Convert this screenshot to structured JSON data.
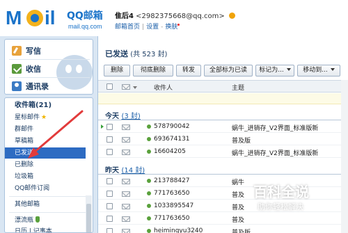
{
  "header": {
    "logo": "MOil QQ邮箱 mail.qq.com",
    "user_name": "隹后4",
    "user_email": "<2982375668@qq.com>",
    "links": [
      "邮箱首页",
      "设置",
      "换肤"
    ]
  },
  "sidebar": {
    "quick": [
      {
        "label": "写信",
        "icon": "compose-icon"
      },
      {
        "label": "收信",
        "icon": "inbox-icon"
      },
      {
        "label": "通讯录",
        "icon": "contacts-icon"
      }
    ],
    "folders": [
      {
        "label": "收件箱(21)"
      },
      {
        "label": "星标邮件"
      },
      {
        "label": "群邮件"
      },
      {
        "label": "草稿箱"
      },
      {
        "label": "已发送"
      },
      {
        "label": "已删除"
      },
      {
        "label": "垃圾箱"
      },
      {
        "label": "QQ邮件订阅"
      },
      {
        "label": "其他邮箱"
      },
      {
        "label": "漂流瓶"
      },
      {
        "label": "日历 | 记事本"
      }
    ]
  },
  "main": {
    "title": "已发送",
    "count_text": "(共 523 封)",
    "toolbar": {
      "delete": "删除",
      "perm_delete": "彻底删除",
      "forward": "转发",
      "mark_all_read": "全部标为已读",
      "mark_as": "标记为...",
      "move_to": "移动到..."
    },
    "columns": {
      "recipient": "收件人",
      "subject": "主题"
    },
    "groups": [
      {
        "label": "今天",
        "count": "(3 封)",
        "rows": [
          {
            "recipient": "578790042",
            "subject": "蜗牛_进销存_V2界面_标准版新"
          },
          {
            "recipient": "693674131",
            "subject": "普及版"
          },
          {
            "recipient": "16604205",
            "subject": "蜗牛_进销存_V2界面_标准版新"
          }
        ]
      },
      {
        "label": "昨天",
        "count": "(14 封)",
        "rows": [
          {
            "recipient": "213788427",
            "subject": "蜗牛"
          },
          {
            "recipient": "771763650",
            "subject": "普及"
          },
          {
            "recipient": "1033895547",
            "subject": "普及"
          },
          {
            "recipient": "771763650",
            "subject": "普及"
          },
          {
            "recipient": "heiminqyu3240",
            "subject": "普及版"
          }
        ]
      }
    ]
  },
  "watermark": {
    "title": "百科全说",
    "subtitle": "助你轻松解决"
  },
  "colors": {
    "accent": "#2d6bc2",
    "sidebar_bg": "#d9e6f3",
    "arrow": "#e23b3b"
  }
}
